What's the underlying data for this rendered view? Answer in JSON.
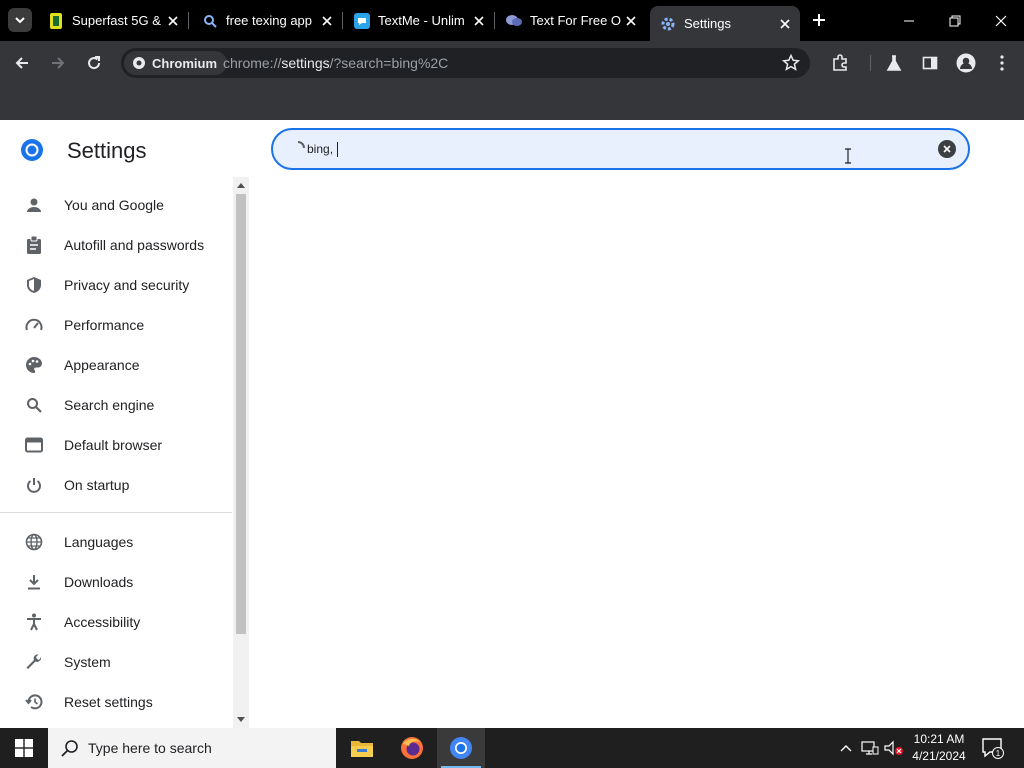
{
  "browser": {
    "tabs": [
      {
        "title": "Superfast 5G & ",
        "icon": "green-tile-icon"
      },
      {
        "title": "free texing app",
        "icon": "search-tab-icon"
      },
      {
        "title": "TextMe - Unlim",
        "icon": "textme-icon"
      },
      {
        "title": "Text For Free O",
        "icon": "chat-bubbles-icon"
      },
      {
        "title": "Settings",
        "icon": "gear-icon",
        "active": true
      }
    ],
    "omnibox": {
      "chip_label": "Chromium",
      "url_scheme": "chrome://",
      "url_host": "settings",
      "url_path": "/?search=bing%2C"
    }
  },
  "settings": {
    "title": "Settings",
    "search_value": "bing,",
    "nav_top": [
      {
        "label": "You and Google",
        "icon": "person-icon"
      },
      {
        "label": "Autofill and passwords",
        "icon": "clipboard-icon"
      },
      {
        "label": "Privacy and security",
        "icon": "shield-icon"
      },
      {
        "label": "Performance",
        "icon": "speedometer-icon"
      },
      {
        "label": "Appearance",
        "icon": "palette-icon"
      },
      {
        "label": "Search engine",
        "icon": "magnifier-icon"
      },
      {
        "label": "Default browser",
        "icon": "browser-window-icon"
      },
      {
        "label": "On startup",
        "icon": "power-icon"
      }
    ],
    "nav_bottom": [
      {
        "label": "Languages",
        "icon": "globe-icon"
      },
      {
        "label": "Downloads",
        "icon": "download-icon"
      },
      {
        "label": "Accessibility",
        "icon": "accessibility-icon"
      },
      {
        "label": "System",
        "icon": "wrench-icon"
      },
      {
        "label": "Reset settings",
        "icon": "history-icon"
      }
    ]
  },
  "taskbar": {
    "search_placeholder": "Type here to search",
    "time": "10:21 AM",
    "date": "4/21/2024",
    "notification_count": "1"
  },
  "colors": {
    "accent": "#1a73e8",
    "search_bg": "#e8f0fe",
    "toolbar": "#35363a",
    "tabstrip": "#000000"
  }
}
